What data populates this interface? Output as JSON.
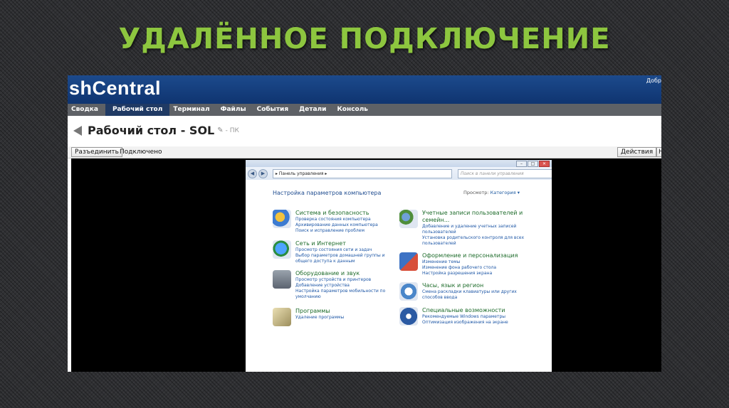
{
  "slide": {
    "title": "УДАЛЁННОЕ ПОДКЛЮЧЕНИЕ"
  },
  "app": {
    "brand": "shCentral",
    "user_fragment": "Добр",
    "tabs": [
      "Сводка",
      "Рабочий стол",
      "Терминал",
      "Файлы",
      "События",
      "Детали",
      "Консоль"
    ],
    "active_tab": "Рабочий стол",
    "desktop_title": "Рабочий стол - SOL",
    "desktop_sub": "- ПК",
    "disconnect_label": "Разъединить",
    "status": "Подключено",
    "actions_label": "Действия",
    "next_fragment": "Н"
  },
  "remote": {
    "address": "▸ Панель управления ▸",
    "search_placeholder": "Поиск в панели управления",
    "heading": "Настройка параметров компьютера",
    "view_by_label": "Просмотр:",
    "view_by_value": "Категория ▾",
    "categories": [
      {
        "title": "Система и безопасность",
        "icon": "shield-icon",
        "links": [
          "Проверка состояния компьютера",
          "Архивирование данных компьютера",
          "Поиск и исправление проблем"
        ]
      },
      {
        "title": "Сеть и Интернет",
        "icon": "network-icon",
        "links": [
          "Просмотр состояния сети и задач",
          "Выбор параметров домашней группы и",
          "общего доступа к данным"
        ]
      },
      {
        "title": "Оборудование и звук",
        "icon": "printer-icon",
        "links": [
          "Просмотр устройств и принтеров",
          "Добавление устройства",
          "Настройка параметров мобильности по",
          "умолчанию"
        ]
      },
      {
        "title": "Программы",
        "icon": "programs-icon",
        "links": [
          "Удаление программы"
        ]
      },
      {
        "title": "Учетные записи пользователей и",
        "title2": "семейн...",
        "icon": "users-icon",
        "links": [
          "Добавление и удаление учетных записей",
          "пользователей",
          "Установка родительского контроля для всех",
          "пользователей"
        ]
      },
      {
        "title": "Оформление и персонализация",
        "icon": "appearance-icon",
        "links": [
          "Изменение темы",
          "Изменение фона рабочего стола",
          "Настройка разрешения экрана"
        ]
      },
      {
        "title": "Часы, язык и регион",
        "icon": "clock-icon",
        "links": [
          "Смена раскладки клавиатуры или других",
          "способов ввода"
        ]
      },
      {
        "title": "Специальные возможности",
        "icon": "accessibility-icon",
        "links": [
          "Рекомендуемые Windows параметры",
          "Оптимизация изображения на экране"
        ]
      }
    ]
  }
}
